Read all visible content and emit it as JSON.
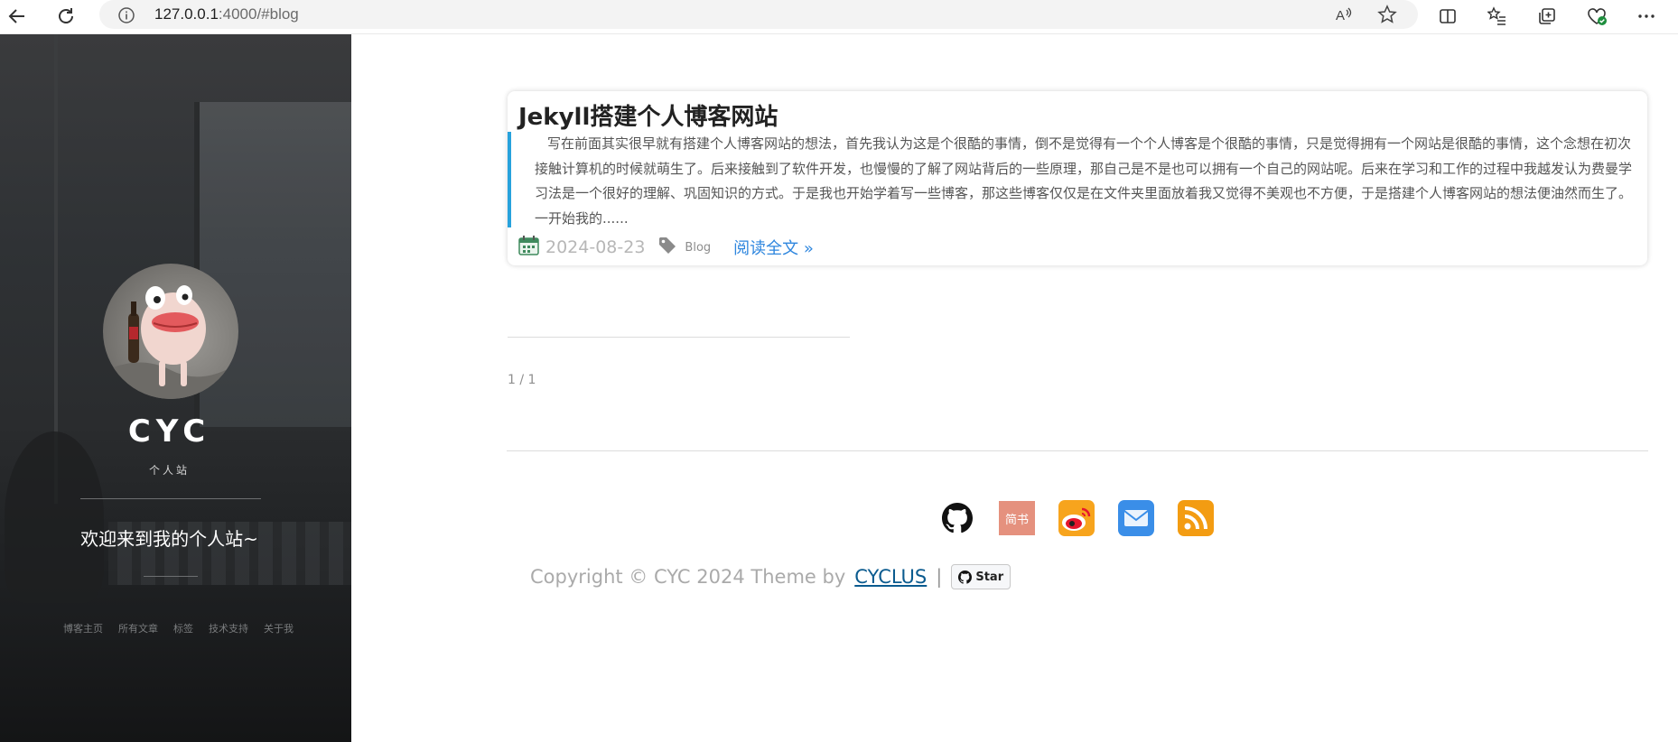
{
  "browser": {
    "url_host": "127.0.0.1",
    "url_rest": ":4000/#blog"
  },
  "sidebar": {
    "title": "CYC",
    "subtitle": "个人站",
    "welcome": "欢迎来到我的个人站~",
    "nav": [
      {
        "label": "博客主页"
      },
      {
        "label": "所有文章"
      },
      {
        "label": "标签"
      },
      {
        "label": "技术支持"
      },
      {
        "label": "关于我"
      }
    ]
  },
  "post": {
    "title": "Jekyll搭建个人博客网站",
    "excerpt": "写在前面其实很早就有搭建个人博客网站的想法，首先我认为这是个很酷的事情，倒不是觉得有一个个人博客是个很酷的事情，只是觉得拥有一个网站是很酷的事情，这个念想在初次接触计算机的时候就萌生了。后来接触到了软件开发，也慢慢的了解了网站背后的一些原理，那自己是不是也可以拥有一个自己的网站呢。后来在学习和工作的过程中我越发认为费曼学习法是一个很好的理解、巩固知识的方式。于是我也开始学着写一些博客，那这些博客仅仅是在文件夹里面放着我又觉得不美观也不方便，于是搭建个人博客网站的想法便油然而生了。一开始我的......",
    "date": "2024-08-23",
    "tag": "Blog",
    "read_more": "阅读全文 »"
  },
  "pagination": "1 / 1",
  "footer": {
    "social_icons": [
      "github-icon",
      "jianshu-icon",
      "weibo-icon",
      "email-icon",
      "rss-icon"
    ],
    "jianshu_text": "简书",
    "copyright_text": "Copyright © CYC 2024 Theme by",
    "theme_link": "CYCLUS",
    "separator": "|",
    "star_label": "Star"
  },
  "colors": {
    "accent_blue": "#27a2dc",
    "link_blue": "#2e86de",
    "sidebar_bg": "#2a2c2e"
  }
}
